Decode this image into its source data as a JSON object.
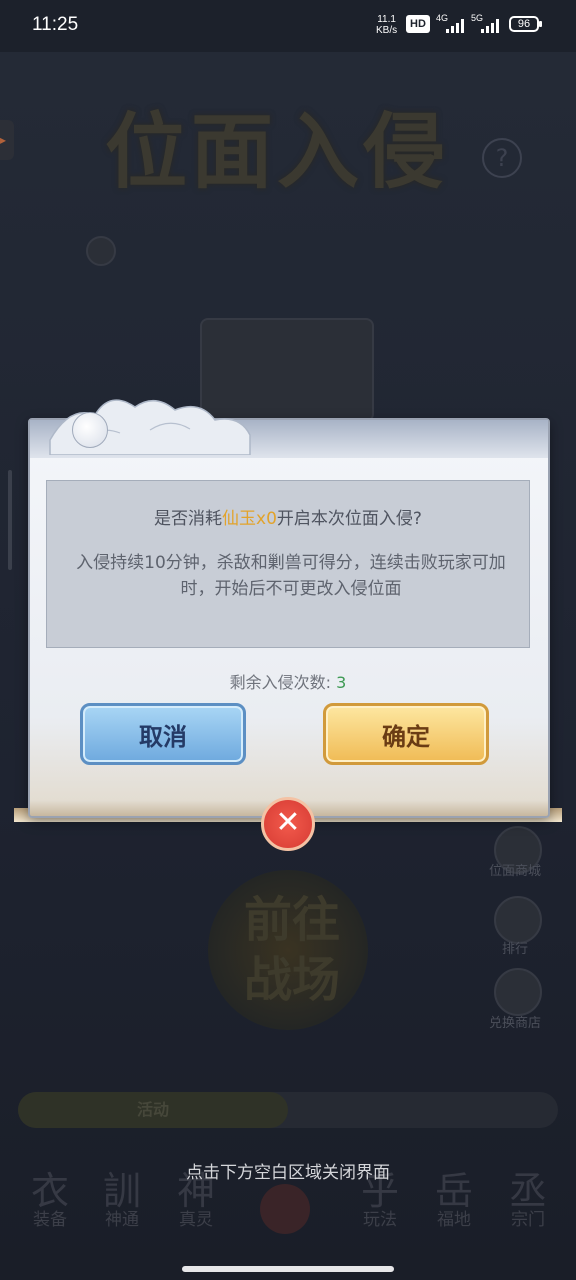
{
  "status_bar": {
    "time": "11:25",
    "net_speed": "11.1",
    "net_unit": "KB/s",
    "hd": "HD",
    "sig1": "4G",
    "sig2": "5G",
    "battery": "96"
  },
  "background": {
    "title": "位面入侵",
    "help_icon": "question-icon",
    "go_button": "前往战场",
    "activity_tab": "活动",
    "right_items": [
      "位面商城",
      "排行",
      "兑换商店"
    ],
    "nav": [
      "装备",
      "神通",
      "真灵",
      "",
      "玩法",
      "福地",
      "宗门"
    ]
  },
  "dialog": {
    "question_prefix": "是否消耗",
    "question_item": "仙玉x0",
    "question_suffix": "开启本次位面入侵?",
    "description": "入侵持续10分钟，杀敌和剿兽可得分，连续击败玩家可加时，开始后不可更改入侵位面",
    "remaining_label": "剩余入侵次数:",
    "remaining_count": "3",
    "cancel_label": "取消",
    "confirm_label": "确定",
    "close_icon": "close-icon"
  },
  "hint": "点击下方空白区域关闭界面",
  "colors": {
    "highlight": "#e2a32b",
    "count": "#3e9a54",
    "close_red": "#e0463b"
  }
}
